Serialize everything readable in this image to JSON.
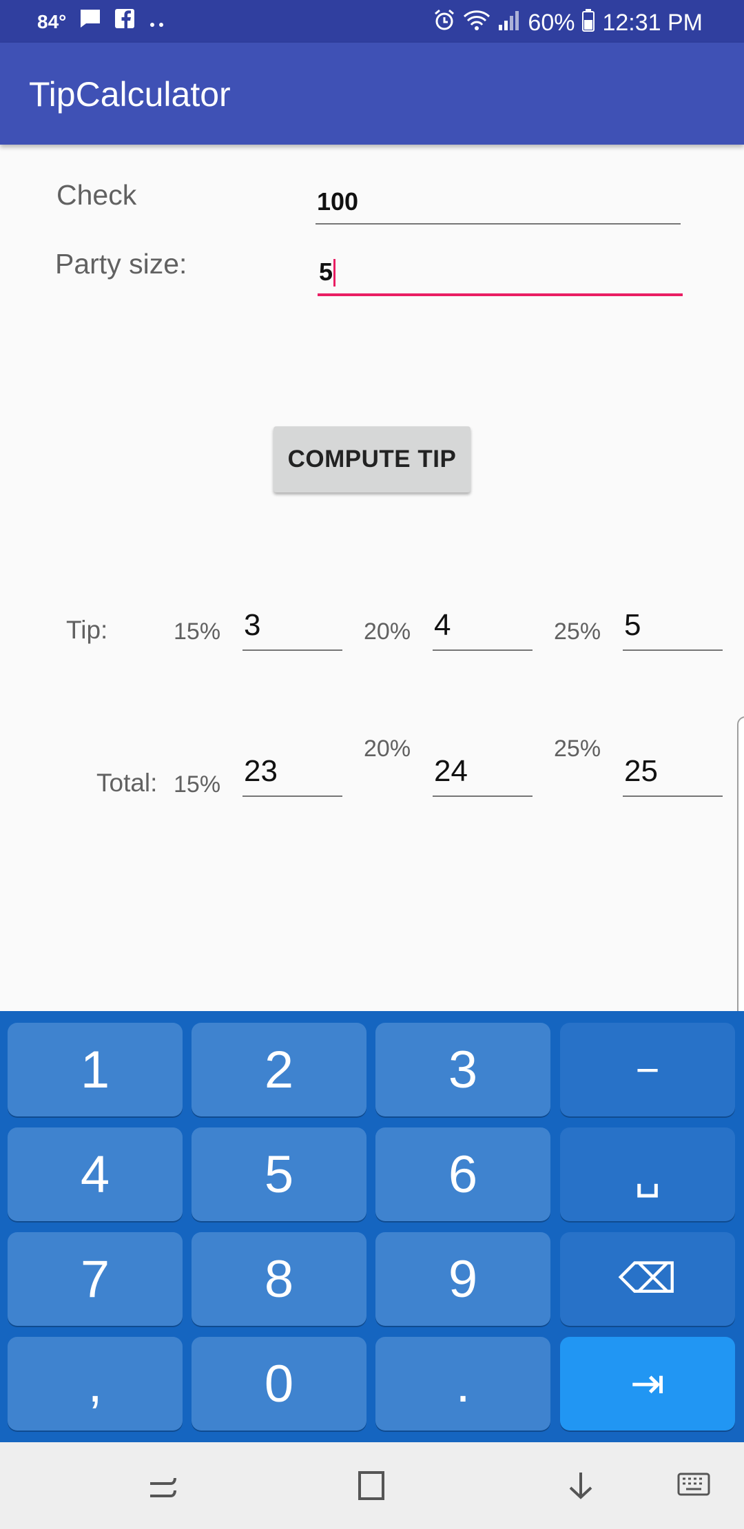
{
  "status": {
    "temp": "84°",
    "battery": "60%",
    "time": "12:31 PM"
  },
  "app": {
    "title": "TipCalculator"
  },
  "form": {
    "check_label": "Check",
    "check_value": "100",
    "party_label": "Party size:",
    "party_value": "5"
  },
  "button": {
    "label": "COMPUTE TIP"
  },
  "tip": {
    "label": "Tip:",
    "items": [
      {
        "pct": "15%",
        "value": "3"
      },
      {
        "pct": "20%",
        "value": "4"
      },
      {
        "pct": "25%",
        "value": "5"
      }
    ]
  },
  "total": {
    "label": "Total:",
    "items": [
      {
        "pct": "15%",
        "value": "23"
      },
      {
        "pct": "20%",
        "value": "24"
      },
      {
        "pct": "25%",
        "value": "25"
      }
    ]
  },
  "keyboard": {
    "keys": [
      "1",
      "2",
      "3",
      "−",
      "4",
      "5",
      "6",
      "␣",
      "7",
      "8",
      "9",
      "⌫",
      ",",
      "0",
      ".",
      "⇥"
    ]
  },
  "colors": {
    "status_bar": "#303f9f",
    "app_bar": "#3f51b5",
    "accent": "#e91e63",
    "keyboard": "#1565c0"
  }
}
